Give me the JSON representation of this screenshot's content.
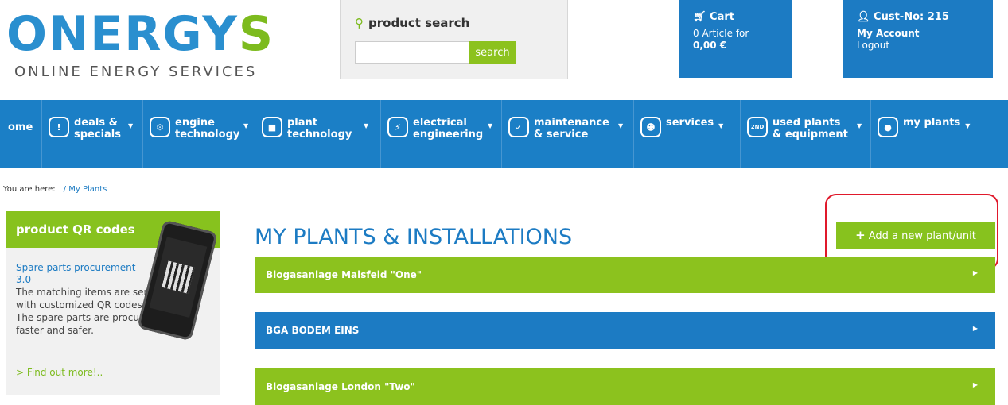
{
  "header": {
    "logo_part1": "ON",
    "logo_part2": "ERGY",
    "logo_part3": "S",
    "tagline": "ONLINE ENERGY SERVICES",
    "search_title": "product search",
    "search_placeholder": "",
    "search_button": "search",
    "cart_title": "Cart",
    "cart_line1": "0 Article for",
    "cart_line2": "0,00 €",
    "cust_title": "Cust-No: 215",
    "my_account": "My Account",
    "logout": "Logout"
  },
  "nav": [
    {
      "label": "ome",
      "icon": ""
    },
    {
      "label": "deals & specials",
      "icon": "!"
    },
    {
      "label": "engine technology",
      "icon": "engine"
    },
    {
      "label": "plant technology",
      "icon": "plant"
    },
    {
      "label": "electrical engineering",
      "icon": "chip"
    },
    {
      "label": "maintenance & service",
      "icon": "checklist"
    },
    {
      "label": "services",
      "icon": "person"
    },
    {
      "label": "used plants & equipment",
      "icon": "2ND"
    },
    {
      "label": "my plants",
      "icon": "tank"
    }
  ],
  "breadcrumb": {
    "prefix": "You are here:",
    "path": "/ My Plants"
  },
  "sidebar": {
    "heading": "product QR codes",
    "title": "Spare parts procurement 3.0",
    "text": "The matching items are sent with customized QR codes. The spare parts are procured faster and safer.",
    "more": "> Find out more!.."
  },
  "main": {
    "title": "MY PLANTS & INSTALLATIONS",
    "add_button": "Add a new plant/unit",
    "plants": [
      {
        "name": "Biogasanlage Maisfeld \"One\"",
        "color": "#8cc21e"
      },
      {
        "name": "BGA BODEM EINS",
        "color": "#1c7bc3"
      },
      {
        "name": "Biogasanlage London \"Two\"",
        "color": "#8cc21e"
      }
    ]
  },
  "colors": {
    "brand_blue": "#1c7bc3",
    "brand_green": "#8cc21e",
    "highlight_red": "#e0192b"
  }
}
